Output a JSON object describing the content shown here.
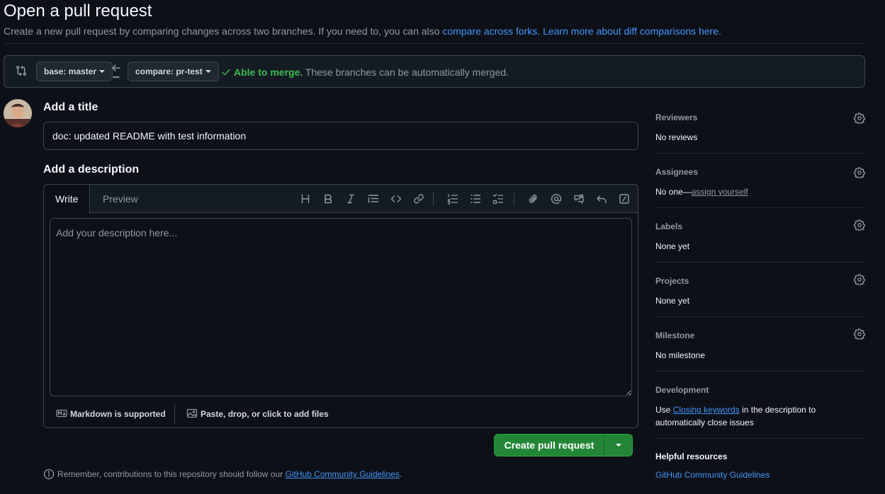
{
  "header": {
    "title": "Open a pull request",
    "subtitle_text": "Create a new pull request by comparing changes across two branches. If you need to, you can also ",
    "compare_forks_link": "compare across forks.",
    "learn_more_link": "Learn more about diff comparisons here."
  },
  "compare": {
    "base_label": "base: master",
    "compare_label": "compare: pr-test",
    "merge_ok": "Able to merge.",
    "merge_text": " These branches can be automatically merged."
  },
  "form": {
    "title_heading": "Add a title",
    "title_value": "doc: updated README with test information",
    "description_heading": "Add a description",
    "tabs": {
      "write": "Write",
      "preview": "Preview"
    },
    "description_placeholder": "Add your description here...",
    "markdown_note": "Markdown is supported",
    "attach_note": "Paste, drop, or click to add files",
    "create_button": "Create pull request",
    "guidelines_prefix": "Remember, contributions to this repository should follow our ",
    "guidelines_link": "GitHub Community Guidelines",
    "guidelines_suffix": "."
  },
  "toolbar_icons": [
    "heading-icon",
    "bold-icon",
    "italic-icon",
    "quote-icon",
    "code-icon",
    "link-icon",
    "ordered-list-icon",
    "unordered-list-icon",
    "task-list-icon",
    "attach-icon",
    "mention-icon",
    "reference-icon",
    "undo-icon",
    "slash-command-icon"
  ],
  "sidebar": {
    "reviewers": {
      "title": "Reviewers",
      "value": "No reviews"
    },
    "assignees": {
      "title": "Assignees",
      "value_prefix": "No one—",
      "value_link": "assign yourself"
    },
    "labels": {
      "title": "Labels",
      "value": "None yet"
    },
    "projects": {
      "title": "Projects",
      "value": "None yet"
    },
    "milestone": {
      "title": "Milestone",
      "value": "No milestone"
    },
    "development": {
      "title": "Development",
      "value_prefix": "Use ",
      "value_link": "Closing keywords",
      "value_suffix": " in the description to automatically close issues"
    },
    "helpful": {
      "title": "Helpful resources",
      "link": "GitHub Community Guidelines"
    }
  },
  "colors": {
    "background": "#0d1117",
    "accent_link": "#4493f8",
    "success": "#3fb950",
    "primary_button": "#238636"
  }
}
